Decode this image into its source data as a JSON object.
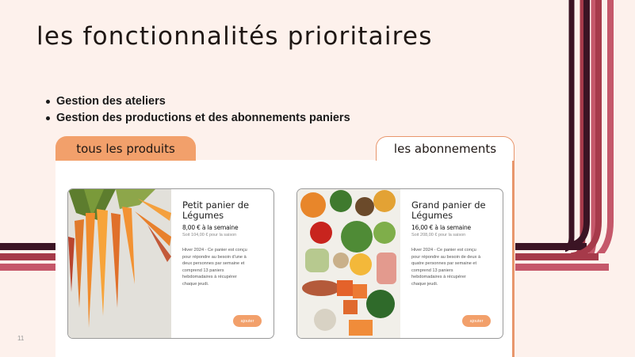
{
  "slide": {
    "title": "les fonctionnalités prioritaires",
    "page_number": "11"
  },
  "bullets": [
    "Gestion des ateliers",
    "Gestion des productions et des abonnements paniers"
  ],
  "tabs": {
    "products": "tous les produits",
    "subscriptions": "les abonnements"
  },
  "cards": [
    {
      "title_line1": "Petit panier de",
      "title_line2": "Légumes",
      "price": "8,00 € à la semaine",
      "subtotal": "Soit 104,00 € pour la saison",
      "desc_line1": "Hiver 2024 - Ce panier est conçu",
      "desc_line2": "pour répondre au besoin d'une à",
      "desc_line3": "deux personnes par semaine et",
      "desc_line4": "comprend 13 paniers",
      "desc_line5": "hebdomadaires à récupérer",
      "desc_line6": "chaque jeudi.",
      "button": "ajouter",
      "image": "carrots-photo-icon"
    },
    {
      "title_line1": "Grand panier de",
      "title_line2": "Légumes",
      "price": "16,00 € à la semaine",
      "subtotal": "Soit 208,00 € pour la saison",
      "desc_line1": "Hiver 2024 - Ce panier est conçu",
      "desc_line2": "pour répondre au besoin de deux à",
      "desc_line3": "quatre personnes par semaine et",
      "desc_line4": "comprend 13 paniers",
      "desc_line5": "hebdomadaires à récupérer",
      "desc_line6": "chaque jeudi.",
      "button": "ajouter",
      "image": "vegetables-photo-icon"
    }
  ],
  "colors": {
    "background": "#fdf1ec",
    "accent": "#f2a06b",
    "stripe_dark": "#3b1424",
    "stripe_red": "#a63a4a",
    "stripe_rose": "#c5586a"
  }
}
